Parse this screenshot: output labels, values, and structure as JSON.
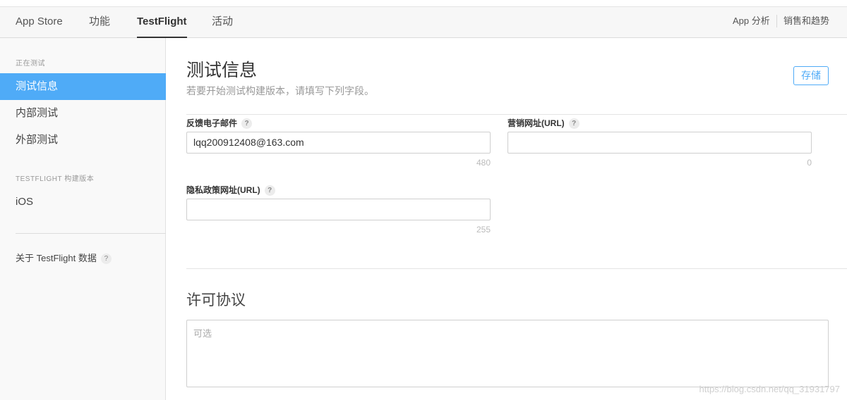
{
  "topnav": {
    "tabs": [
      {
        "label": "App Store",
        "active": false
      },
      {
        "label": "功能",
        "active": false
      },
      {
        "label": "TestFlight",
        "active": true
      },
      {
        "label": "活动",
        "active": false
      }
    ],
    "right_links": [
      "App 分析",
      "销售和趋势"
    ]
  },
  "sidebar": {
    "section1_heading": "正在测试",
    "section1_items": [
      {
        "label": "测试信息",
        "active": true
      },
      {
        "label": "内部测试",
        "active": false
      },
      {
        "label": "外部测试",
        "active": false
      }
    ],
    "section2_heading": "TESTFLIGHT 构建版本",
    "section2_items": [
      {
        "label": "iOS",
        "active": false
      }
    ],
    "about_label": "关于 TestFlight 数据",
    "help_glyph": "?"
  },
  "main": {
    "title": "测试信息",
    "subtitle": "若要开始测试构建版本，请填写下列字段。",
    "save_label": "存储",
    "fields": {
      "feedback_email": {
        "label": "反馈电子邮件",
        "value": "lqq200912408@163.com",
        "counter": "480"
      },
      "marketing_url": {
        "label": "营销网址(URL)",
        "value": "",
        "counter": "0"
      },
      "privacy_url": {
        "label": "隐私政策网址(URL)",
        "value": "",
        "counter": "255"
      }
    },
    "license": {
      "title": "许可协议",
      "placeholder": "可选"
    }
  },
  "watermark": "https://blog.csdn.net/qq_31931797",
  "colors": {
    "accent": "#4fabf7",
    "sidebar_bg": "#f9f9f9",
    "topnav_bg": "#f7f7f7"
  }
}
